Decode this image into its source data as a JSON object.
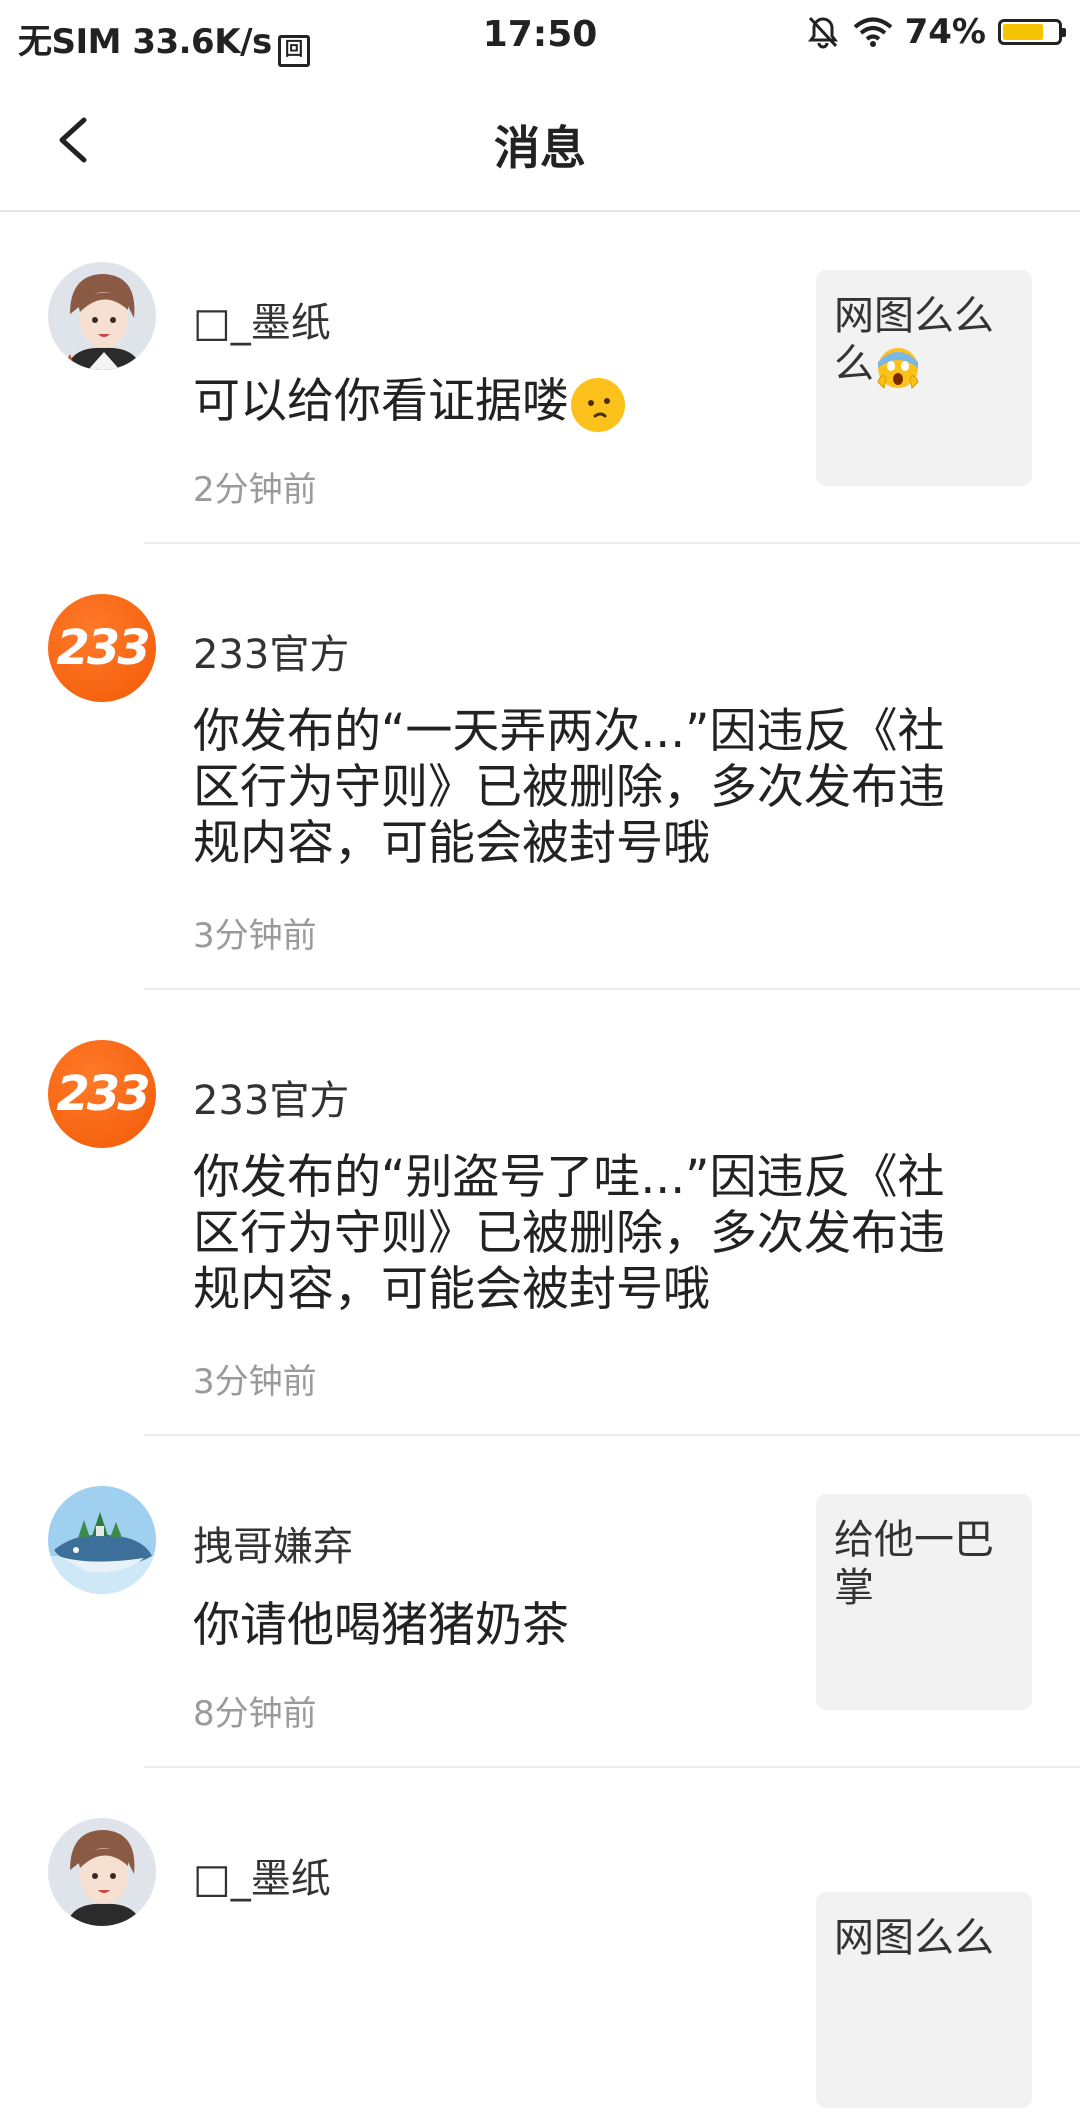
{
  "status_bar": {
    "carrier": "无SIM",
    "speed": "33.6K/s",
    "sim_icon_text": "回",
    "time": "17:50",
    "battery": "74%",
    "battery_level": 0.74,
    "battery_color": "#f5c400"
  },
  "nav": {
    "title": "消息"
  },
  "messages": [
    {
      "name": "□_墨纸",
      "text": "可以给你看证据喽",
      "time": "2分钟前",
      "thumb": "网图么么么",
      "avatar": "boy-avatar",
      "emoji": "smirk"
    },
    {
      "name": "233官方",
      "text": "你发布的“一天弄两次...”因违反《社区行为守则》已被删除，多次发布违规内容，可能会被封号哦",
      "time": "3分钟前",
      "avatar_text": "233"
    },
    {
      "name": "233官方",
      "text": "你发布的“别盗号了哇...”因违反《社区行为守则》已被删除，多次发布违规内容，可能会被封号哦",
      "time": "3分钟前",
      "avatar_text": "233"
    },
    {
      "name": "拽哥嫌弃",
      "text": "你请他喝猪猪奶茶",
      "time": "8分钟前",
      "thumb": "给他一巴掌",
      "avatar": "whale-avatar"
    },
    {
      "name": "□_墨纸",
      "thumb": "网图么么",
      "avatar": "boy-avatar"
    }
  ],
  "colors": {
    "brand_orange": "#f25a06",
    "divider": "#ececec",
    "time_gray": "#9a9a9a"
  }
}
